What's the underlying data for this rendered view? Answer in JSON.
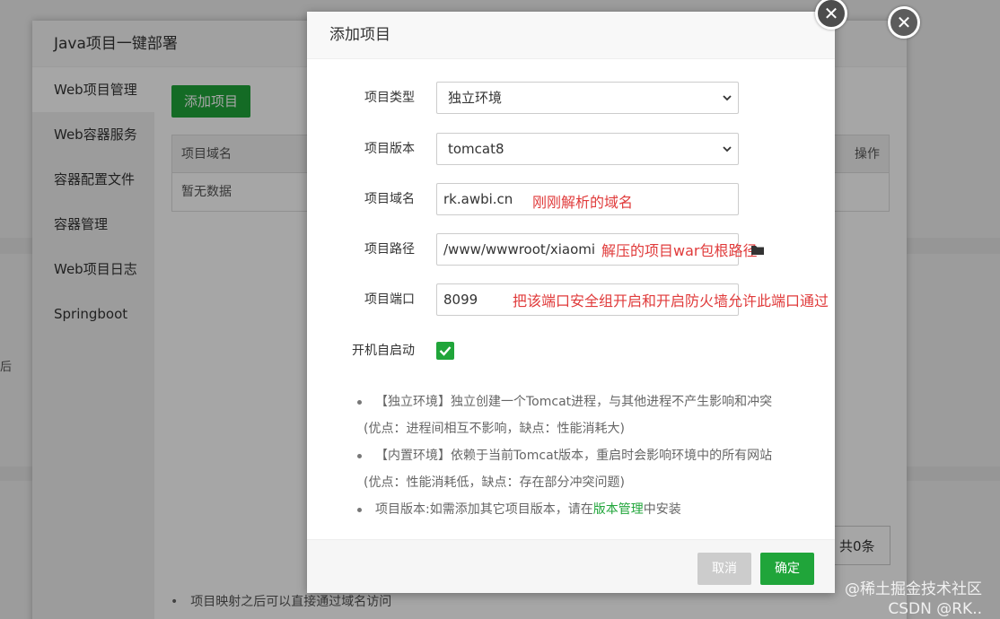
{
  "background": {
    "left_fragment": "后",
    "outer_panel": {
      "title": "Java项目一键部署",
      "sidebar": [
        {
          "label": "Web项目管理"
        },
        {
          "label": "Web容器服务"
        },
        {
          "label": "容器配置文件"
        },
        {
          "label": "容器管理"
        },
        {
          "label": "Web项目日志"
        },
        {
          "label": "Springboot"
        }
      ],
      "add_button": "添加项目",
      "table": {
        "col_domain": "项目域名",
        "col_op": "操作",
        "empty": "暂无数据"
      },
      "count": "共0条",
      "note": "项目映射之后可以直接通过域名访问"
    }
  },
  "modal": {
    "title": "添加项目",
    "fields": {
      "type": {
        "label": "项目类型",
        "value": "独立环境"
      },
      "version": {
        "label": "项目版本",
        "value": "tomcat8"
      },
      "domain": {
        "label": "项目域名",
        "value": "rk.awbi.cn",
        "annotation": "刚刚解析的域名"
      },
      "path": {
        "label": "项目路径",
        "value": "/www/wwwroot/xiaomi",
        "annotation": "解压的项目war包根路径"
      },
      "port": {
        "label": "项目端口",
        "value": "8099",
        "annotation": "把该端口安全组开启和开启防火墙允许此端口通过"
      },
      "autostart": {
        "label": "开机自启动",
        "checked": true
      }
    },
    "notes": {
      "n1": "【独立环境】独立创建一个Tomcat进程，与其他进程不产生影响和冲突",
      "n1_sub": "(优点：进程间相互不影响，缺点：性能消耗大)",
      "n2": "【内置环境】依赖于当前Tomcat版本，重启时会影响环境中的所有网站",
      "n2_sub": "(优点：性能消耗低，缺点：存在部分冲突问题)",
      "n3_prefix": "项目版本:如需添加其它项目版本，请在",
      "n3_link": "版本管理",
      "n3_suffix": "中安装"
    },
    "buttons": {
      "cancel": "取消",
      "ok": "确定"
    }
  },
  "watermark": {
    "line1": "@稀土掘金技术社区",
    "line2": "CSDN @RK.."
  },
  "colors": {
    "accent": "#20a53a",
    "annotation": "#e03b3b"
  }
}
